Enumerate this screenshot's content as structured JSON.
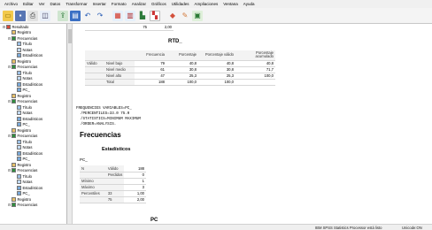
{
  "menubar": [
    "Archivo",
    "Editar",
    "Ver",
    "Datos",
    "Transformar",
    "Insertar",
    "Formato",
    "Analizar",
    "Gráficos",
    "Utilidades",
    "Ampliaciones",
    "Ventana",
    "Ayuda"
  ],
  "toolbar": {
    "icons": [
      "open-folder-icon",
      "save-icon",
      "print-icon",
      "print-preview-icon",
      "export-icon",
      "dialog-recall-icon",
      "undo-icon",
      "redo-icon",
      "goto-data-icon",
      "goto-case-icon",
      "variables-icon",
      "insert-output-icon",
      "designate-window-icon",
      "run-icon"
    ]
  },
  "nav_tree": [
    {
      "level": 0,
      "toggle": "⊟",
      "icon": "output-icon",
      "label": "Resultado"
    },
    {
      "level": 1,
      "toggle": "",
      "icon": "log-icon",
      "label": "Registro"
    },
    {
      "level": 1,
      "toggle": "⊟",
      "icon": "heading-icon",
      "label": "Frecuencias"
    },
    {
      "level": 2,
      "toggle": "",
      "icon": "title-icon",
      "label": "Título"
    },
    {
      "level": 2,
      "toggle": "",
      "icon": "notes-icon",
      "label": "Notas"
    },
    {
      "level": 2,
      "toggle": "",
      "icon": "table-icon",
      "label": "Estadísticos"
    },
    {
      "level": 1,
      "toggle": "",
      "icon": "log-icon",
      "label": "Registro"
    },
    {
      "level": 1,
      "toggle": "⊟",
      "icon": "heading-icon",
      "label": "Frecuencias"
    },
    {
      "level": 2,
      "toggle": "",
      "icon": "title-icon",
      "label": "Título"
    },
    {
      "level": 2,
      "toggle": "",
      "icon": "notes-icon",
      "label": "Notas"
    },
    {
      "level": 2,
      "toggle": "",
      "icon": "table-icon",
      "label": "Estadísticos"
    },
    {
      "level": 2,
      "toggle": "",
      "icon": "table-icon",
      "label": "PC_"
    },
    {
      "level": 1,
      "toggle": "",
      "icon": "log-icon",
      "label": "Registro"
    },
    {
      "level": 1,
      "toggle": "⊟",
      "icon": "heading-icon",
      "label": "Frecuencias"
    },
    {
      "level": 2,
      "toggle": "",
      "icon": "title-icon",
      "label": "Título"
    },
    {
      "level": 2,
      "toggle": "",
      "icon": "notes-icon",
      "label": "Notas"
    },
    {
      "level": 2,
      "toggle": "",
      "icon": "table-icon",
      "label": "Estadísticos"
    },
    {
      "level": 2,
      "toggle": "",
      "icon": "table-icon",
      "label": "PC_"
    },
    {
      "level": 1,
      "toggle": "",
      "icon": "log-icon",
      "label": "Registro"
    },
    {
      "level": 1,
      "toggle": "⊟",
      "icon": "heading-icon",
      "label": "Frecuencias"
    },
    {
      "level": 2,
      "toggle": "",
      "icon": "title-icon",
      "label": "Título"
    },
    {
      "level": 2,
      "toggle": "",
      "icon": "notes-icon",
      "label": "Notas"
    },
    {
      "level": 2,
      "toggle": "",
      "icon": "table-icon",
      "label": "Estadísticos"
    },
    {
      "level": 2,
      "toggle": "",
      "icon": "table-icon",
      "label": "PC_"
    },
    {
      "level": 1,
      "toggle": "",
      "icon": "log-icon",
      "label": "Registro"
    },
    {
      "level": 1,
      "toggle": "⊟",
      "icon": "heading-icon",
      "label": "Frecuencias"
    },
    {
      "level": 2,
      "toggle": "",
      "icon": "title-icon",
      "label": "Título"
    },
    {
      "level": 2,
      "toggle": "",
      "icon": "notes-icon",
      "label": "Notas"
    },
    {
      "level": 2,
      "toggle": "",
      "icon": "table-icon",
      "label": "Estadísticos"
    },
    {
      "level": 2,
      "toggle": "",
      "icon": "table-icon",
      "label": "PC_"
    },
    {
      "level": 1,
      "toggle": "",
      "icon": "log-icon",
      "label": "Registro"
    },
    {
      "level": 1,
      "toggle": "⊟",
      "icon": "heading-icon",
      "label": "Frecuencias"
    }
  ],
  "output": {
    "top_fragment": {
      "label": "75",
      "value": "2,00"
    },
    "rtd_table": {
      "title": "RTD_",
      "headers": [
        "",
        "",
        "Frecuencia",
        "Porcentaje",
        "Porcentaje válido",
        "Porcentaje acumulado"
      ],
      "rows": [
        [
          "Válido",
          "Nivel bajo",
          "79",
          "40,8",
          "40,8",
          "40,8"
        ],
        [
          "",
          "Nivel medio",
          "61",
          "30,8",
          "30,8",
          "71,7"
        ],
        [
          "",
          "Nivel alto",
          "47",
          "25,3",
          "25,3",
          "100,0"
        ],
        [
          "",
          "Total",
          "188",
          "100,0",
          "100,0",
          ""
        ]
      ]
    },
    "syntax": "FREQUENCIES VARIABLES=PC_\n  /PERCENTILES=33.0 75.0\n  /STATISTICS=MINIMUM MAXIMUM\n  /ORDER=ANALYSIS.",
    "frecuencias_title": "Frecuencias",
    "estadisticos": {
      "title": "Estadísticos",
      "variable": "PC_",
      "rows": [
        [
          "N",
          "Válido",
          "188"
        ],
        [
          "",
          "Perdidos",
          "0"
        ],
        [
          "Mínimo",
          "",
          "1"
        ],
        [
          "Máximo",
          "",
          "3"
        ],
        [
          "Percentiles",
          "33",
          "1,00"
        ],
        [
          "",
          "75",
          "2,00"
        ]
      ]
    },
    "bottom_fragment": "PC"
  },
  "statusbar": {
    "processor": "IBM SPSS Statistics Processor está listo",
    "encoding": "Unicode:ON"
  },
  "colors": {
    "menubar_bg": "#f0f0f0",
    "nav_bg": "#ffffff",
    "table_rule": "#d7d7d7"
  }
}
